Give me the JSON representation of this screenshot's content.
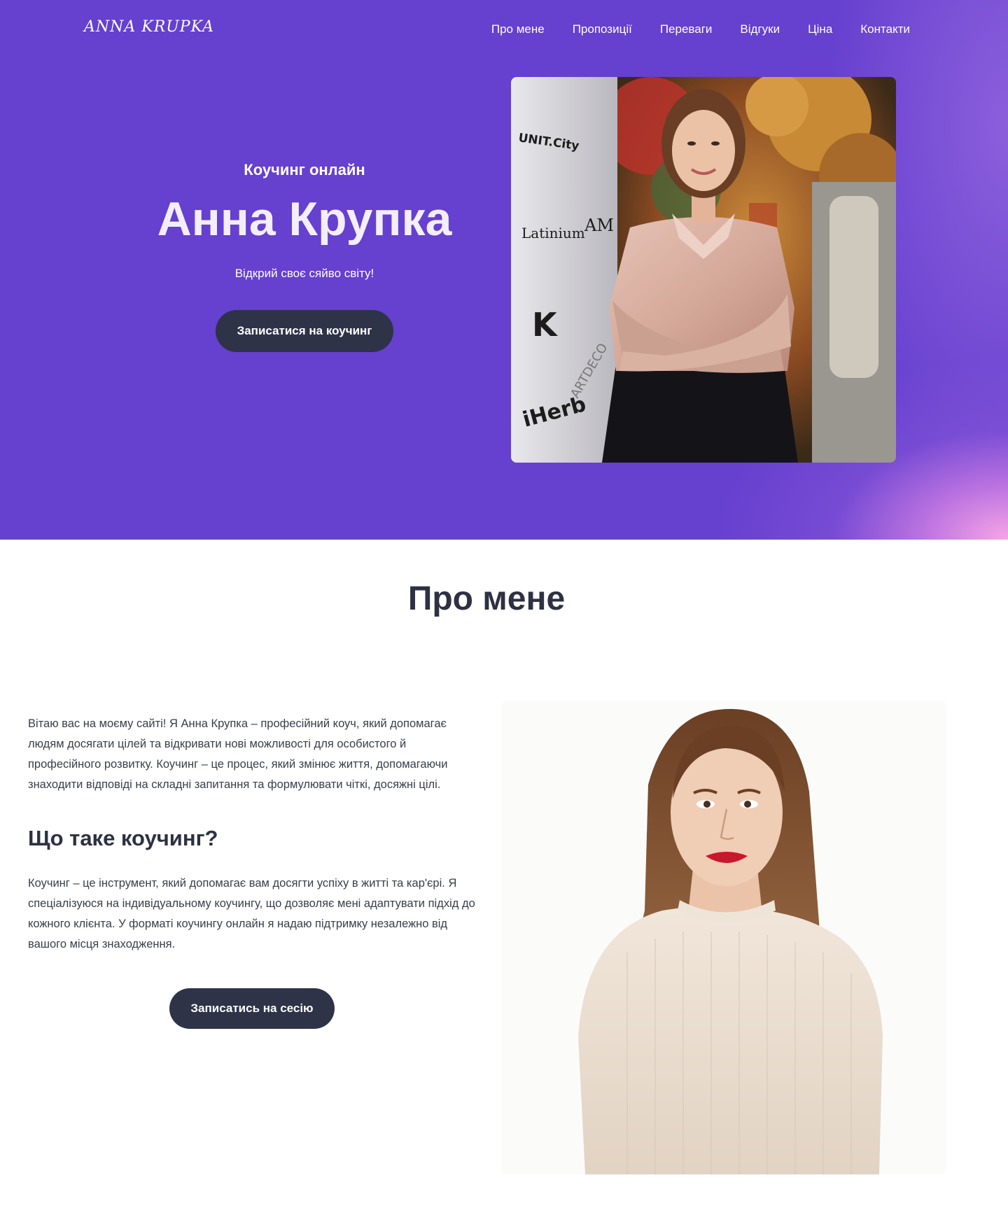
{
  "header": {
    "logo": "ANNA KRUPKA",
    "nav": [
      "Про мене",
      "Пропозиції",
      "Переваги",
      "Відгуки",
      "Ціна",
      "Контакти"
    ]
  },
  "hero": {
    "kicker": "Коучинг онлайн",
    "title": "Анна Крупка",
    "subtitle": "Відкрий своє сяйво світу!",
    "cta": "Записатися на коучинг",
    "photo_board_labels": [
      "UNIT.City",
      "Latinium",
      "AM",
      "iHerb",
      "ARTDECO",
      "K"
    ]
  },
  "about": {
    "title": "Про мене",
    "intro": "Вітаю вас на моєму сайті! Я Анна Крупка – професійний коуч, який допомагає людям досягати цілей та відкривати нові можливості для особистого й професійного розвитку. Коучинг – це процес, який змінює життя, допомагаючи знаходити відповіді на складні запитання та формулювати чіткі, досяжні цілі.",
    "subheading": "Що таке коучинг?",
    "body": "Коучинг – це інструмент, який допомагає вам досягти успіху в житті та кар'єрі. Я спеціалізуюся на індивідуальному коучингу, що дозволяє мені адаптувати підхід до кожного клієнта. У форматі коучингу онлайн я надаю підтримку незалежно від вашого місця знаходження.",
    "cta": "Записатись на сесію"
  },
  "colors": {
    "hero_bg": "#6640cf",
    "button_bg": "#2e3348",
    "heading_text": "#2d3142"
  }
}
